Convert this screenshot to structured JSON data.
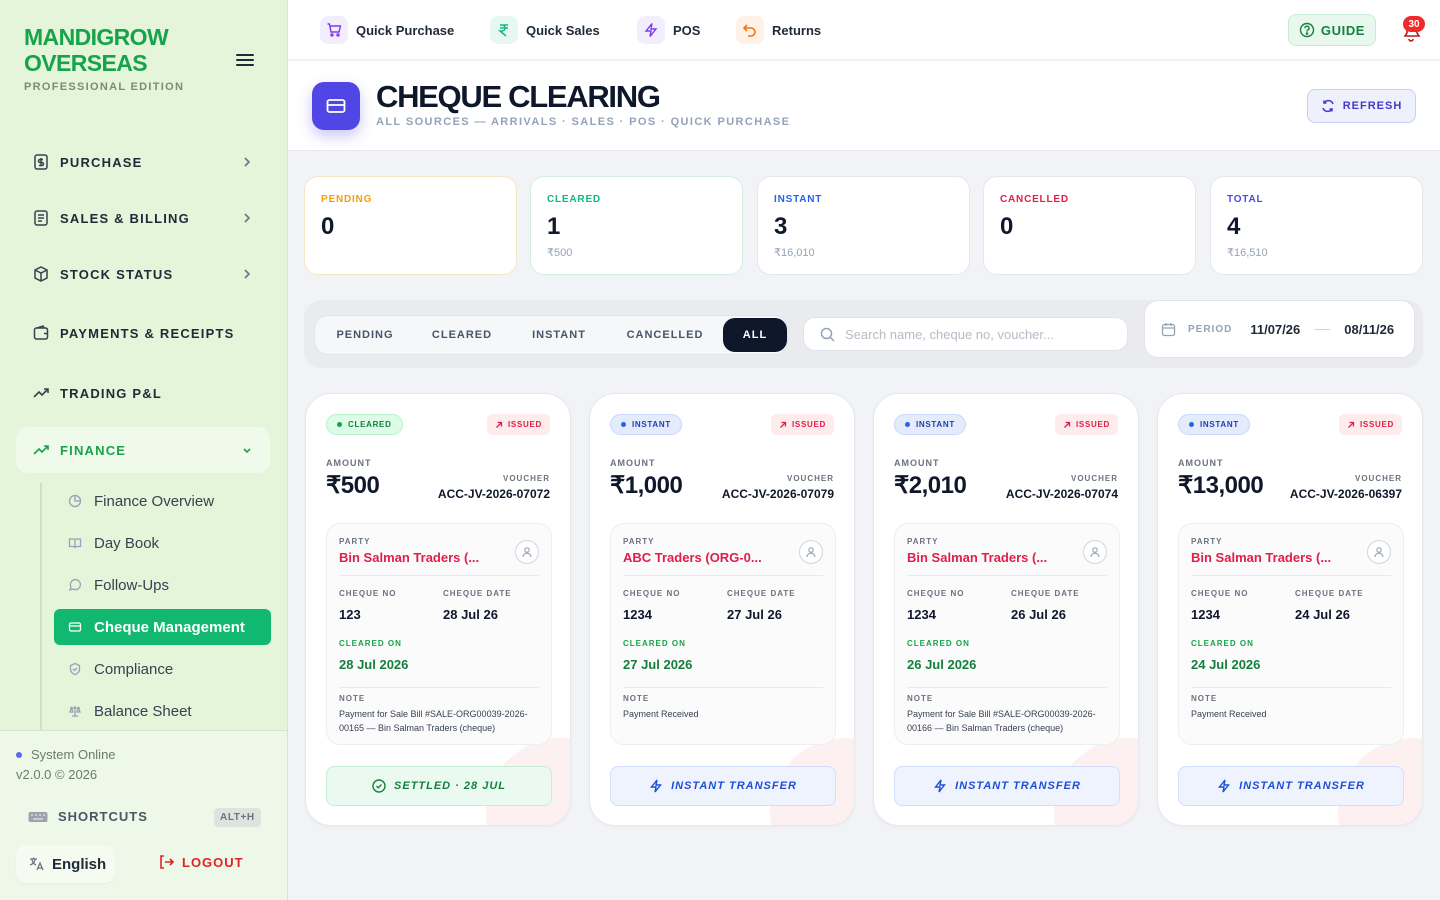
{
  "brand": {
    "line1": "MANDIGROW",
    "line2": "OVERSEAS",
    "edition": "PROFESSIONAL EDITION"
  },
  "nav": {
    "items": [
      {
        "label": "PURCHASE",
        "icon": "receipt-icon"
      },
      {
        "label": "SALES & BILLING",
        "icon": "invoice-icon"
      },
      {
        "label": "STOCK STATUS",
        "icon": "box-icon"
      },
      {
        "label": "PAYMENTS & RECEIPTS",
        "icon": "wallet-icon"
      },
      {
        "label": "TRADING P&L",
        "icon": "trend-icon"
      },
      {
        "label": "FINANCE",
        "icon": "trend-icon",
        "expanded": true
      }
    ],
    "finance_sub": [
      {
        "label": "Finance Overview",
        "icon": "pie-icon"
      },
      {
        "label": "Day Book",
        "icon": "book-icon"
      },
      {
        "label": "Follow-Ups",
        "icon": "chat-icon"
      },
      {
        "label": "Cheque Management",
        "icon": "card-icon",
        "active": true
      },
      {
        "label": "Compliance",
        "icon": "shield-icon"
      },
      {
        "label": "Balance Sheet",
        "icon": "scale-icon"
      }
    ]
  },
  "footer": {
    "status": "System Online",
    "version": "v2.0.0 © 2026",
    "shortcuts_label": "SHORTCUTS",
    "shortcuts_key": "ALT+H",
    "language": "English",
    "logout": "LOGOUT"
  },
  "topbar": {
    "quick_actions": [
      {
        "label": "Quick Purchase",
        "icon": "cart-icon",
        "color": "#7c3aed"
      },
      {
        "label": "Quick Sales",
        "icon": "rupee-icon",
        "color": "#10b981"
      },
      {
        "label": "POS",
        "icon": "bolt-icon",
        "color": "#7c3aed"
      },
      {
        "label": "Returns",
        "icon": "undo-icon",
        "color": "#f97316"
      }
    ],
    "guide": "GUIDE",
    "notifications": "30"
  },
  "header": {
    "title": "CHEQUE CLEARING",
    "subtitle": "ALL SOURCES — ARRIVALS · SALES · POS · QUICK PURCHASE",
    "refresh": "REFRESH"
  },
  "stats": [
    {
      "label": "PENDING",
      "value": "0",
      "sub": "",
      "color": "#f59e0b"
    },
    {
      "label": "CLEARED",
      "value": "1",
      "sub": "₹500",
      "color": "#10b981"
    },
    {
      "label": "INSTANT",
      "value": "3",
      "sub": "₹16,010",
      "color": "#2563eb"
    },
    {
      "label": "CANCELLED",
      "value": "0",
      "sub": "",
      "color": "#e11d48"
    },
    {
      "label": "TOTAL",
      "value": "4",
      "sub": "₹16,510",
      "color": "#4f46e5"
    }
  ],
  "filters": {
    "tabs": [
      "PENDING",
      "CLEARED",
      "INSTANT",
      "CANCELLED",
      "ALL"
    ],
    "active_tab": "ALL",
    "search_placeholder": "Search name, cheque no, voucher...",
    "period_label": "PERIOD",
    "date_from": "11/07/26",
    "date_to": "08/11/26"
  },
  "card_labels": {
    "amount": "AMOUNT",
    "voucher": "VOUCHER",
    "party": "PARTY",
    "cheque_no": "CHEQUE NO",
    "cheque_date": "CHEQUE DATE",
    "cleared_on": "CLEARED ON",
    "note": "NOTE"
  },
  "cheques": [
    {
      "status": "CLEARED",
      "direction": "ISSUED",
      "amount": "₹500",
      "voucher": "ACC-JV-2026-07072",
      "party": "Bin Salman Traders (...",
      "cheque_no": "123",
      "cheque_date": "28 Jul 26",
      "cleared_on": "28 Jul 2026",
      "note": "Payment for Sale Bill #SALE-ORG00039-2026-00165 — Bin Salman Traders (cheque)",
      "action": "SETTLED · 28 JUL"
    },
    {
      "status": "INSTANT",
      "direction": "ISSUED",
      "amount": "₹1,000",
      "voucher": "ACC-JV-2026-07079",
      "party": "ABC Traders (ORG-0...",
      "cheque_no": "1234",
      "cheque_date": "27 Jul 26",
      "cleared_on": "27 Jul 2026",
      "note": "Payment Received",
      "action": "INSTANT TRANSFER"
    },
    {
      "status": "INSTANT",
      "direction": "ISSUED",
      "amount": "₹2,010",
      "voucher": "ACC-JV-2026-07074",
      "party": "Bin Salman Traders (...",
      "cheque_no": "1234",
      "cheque_date": "26 Jul 26",
      "cleared_on": "26 Jul 2026",
      "note": "Payment for Sale Bill #SALE-ORG00039-2026-00166 — Bin Salman Traders (cheque)",
      "action": "INSTANT TRANSFER"
    },
    {
      "status": "INSTANT",
      "direction": "ISSUED",
      "amount": "₹13,000",
      "voucher": "ACC-JV-2026-06397",
      "party": "Bin Salman Traders (...",
      "cheque_no": "1234",
      "cheque_date": "24 Jul 26",
      "cleared_on": "24 Jul 2026",
      "note": "Payment Received",
      "action": "INSTANT TRANSFER"
    }
  ]
}
